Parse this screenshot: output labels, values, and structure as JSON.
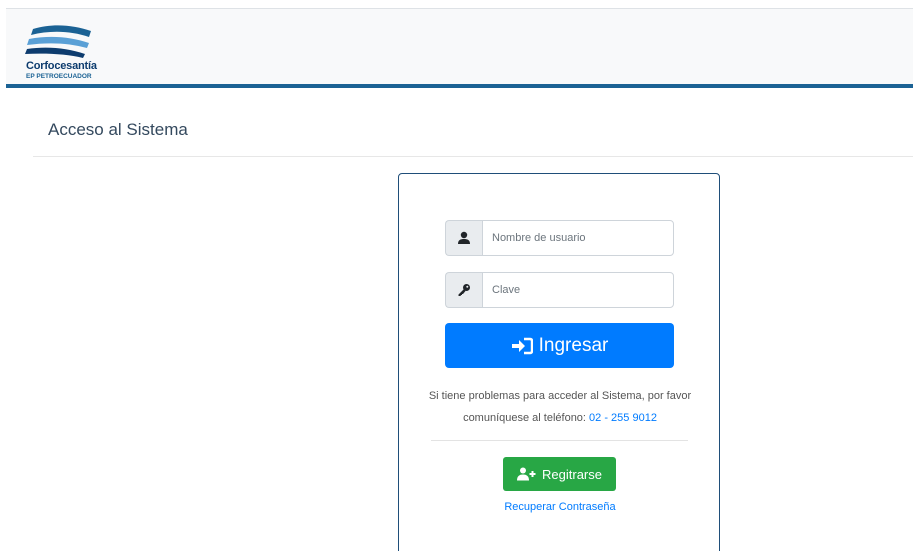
{
  "header": {
    "logo_name": "Corfocesantía",
    "logo_sub": "EP PETROECUADOR"
  },
  "page": {
    "title": "Acceso al Sistema"
  },
  "login": {
    "username_placeholder": "Nombre de usuario",
    "password_placeholder": "Clave",
    "submit_label": "Ingresar",
    "help_text": "Si tiene problemas para acceder al Sistema, por favor comuníquese al teléfono:",
    "phone": "02 - 255 9012",
    "register_label": "Regitrarse",
    "recover_label": "Recuperar Contraseña"
  },
  "icons": {
    "user": "user-icon",
    "password": "key-icon",
    "submit": "sign-in-icon",
    "register": "user-plus-icon"
  },
  "colors": {
    "primary": "#007bff",
    "success": "#28a745",
    "brand": "#1b6294",
    "brand_dark": "#0d3c6e"
  }
}
